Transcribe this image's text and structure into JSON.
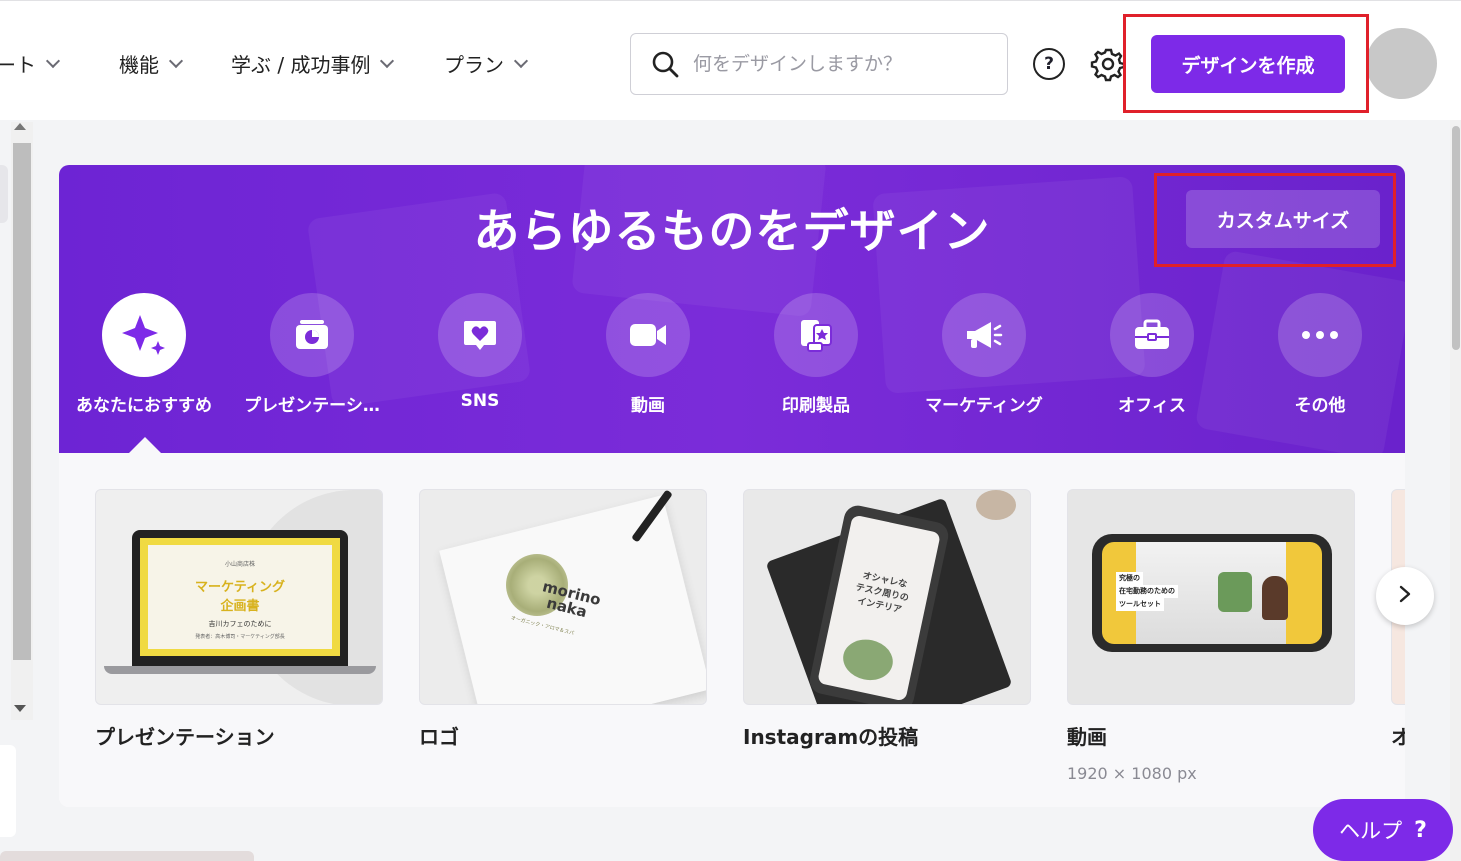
{
  "nav": {
    "items": [
      {
        "label": "ート"
      },
      {
        "label": "機能"
      },
      {
        "label": "学ぶ / 成功事例"
      },
      {
        "label": "プラン"
      }
    ]
  },
  "search": {
    "placeholder": "何をデザインしますか？"
  },
  "header": {
    "help_icon": "question-circle-icon",
    "settings_icon": "gear-icon",
    "create_label": "デザインを作成"
  },
  "hero": {
    "title": "あらゆるものをデザイン",
    "custom_size_label": "カスタムサイズ",
    "categories": [
      {
        "label": "あなたにおすすめ",
        "icon": "sparkle-icon",
        "active": true
      },
      {
        "label": "プレゼンテーシ…",
        "icon": "presentation-icon"
      },
      {
        "label": "SNS",
        "icon": "heart-bubble-icon"
      },
      {
        "label": "動画",
        "icon": "video-camera-icon"
      },
      {
        "label": "印刷製品",
        "icon": "print-icon"
      },
      {
        "label": "マーケティング",
        "icon": "megaphone-icon"
      },
      {
        "label": "オフィス",
        "icon": "briefcase-icon"
      },
      {
        "label": "その他",
        "icon": "more-icon"
      }
    ]
  },
  "cards": [
    {
      "title": "プレゼンテーション",
      "subtitle": "",
      "thumb_text": {
        "line1": "小山商店株",
        "line2": "マーケティング",
        "line3": "企画書",
        "line4": "吉川カフェのために",
        "line5": "発表者：高木博司・マーケティング部長"
      }
    },
    {
      "title": "ロゴ",
      "subtitle": "",
      "thumb_text": {
        "line1": "morino",
        "line2": "naka",
        "line3": "オーガニック・アロマ＆スパ"
      }
    },
    {
      "title": "Instagramの投稿",
      "subtitle": "",
      "thumb_text": {
        "line1": "オシャレな",
        "line2": "テスク周りの",
        "line3": "インテリア"
      }
    },
    {
      "title": "動画",
      "subtitle": "1920 × 1080 px",
      "thumb_text": {
        "line1": "究極の",
        "line2": "在宅勤務のための",
        "line3": "ツールセット"
      }
    },
    {
      "title": "オ",
      "subtitle": ""
    }
  ],
  "help_button": {
    "label": "ヘルプ",
    "mark": "?"
  },
  "colors": {
    "accent": "#7d2ae8",
    "hero": "#7b2cd9",
    "highlight": "#e0202a"
  }
}
